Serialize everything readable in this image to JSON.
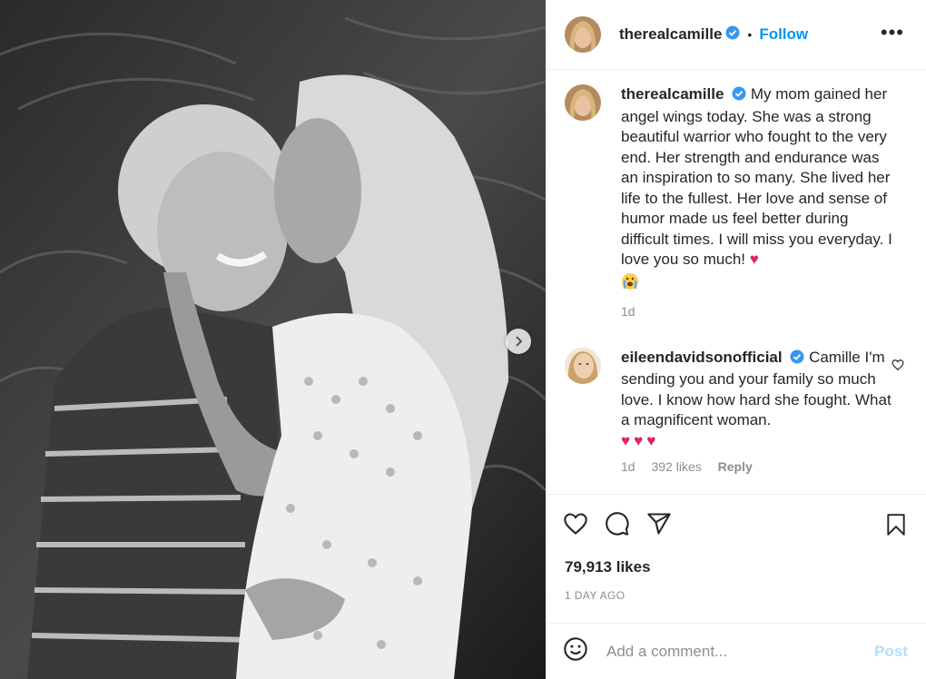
{
  "post": {
    "author": "therealcamille",
    "follow_label": "Follow",
    "dot": "•",
    "more": "•••"
  },
  "caption": {
    "username": "therealcamille",
    "text": "My mom gained her angel wings today. She was a strong beautiful warrior who fought to the very end. Her strength and endurance was an inspiration to so many. She lived her life to the fullest. Her love and sense of humor made us feel better during difficult times. I will miss you everyday. I love you so much!",
    "heart": "♥",
    "time": "1d"
  },
  "comment": {
    "username": "eileendavidsonofficial",
    "text": "Camille I'm sending you and your family so much love. I know how hard she fought. What a magnificent woman.",
    "hearts": "♥♥♥",
    "time": "1d",
    "likes": "392 likes",
    "reply": "Reply"
  },
  "stats": {
    "likes": "79,913 likes",
    "posted": "1 DAY AGO"
  },
  "composer": {
    "placeholder": "Add a comment...",
    "post_label": "Post"
  },
  "icons": {
    "like": "heart-icon",
    "comment": "comment-icon",
    "share": "share-icon",
    "save": "bookmark-icon",
    "emoji": "emoji-icon",
    "next": "chevron-right-icon",
    "verified": "verified-badge-icon"
  },
  "colors": {
    "accent": "#0095f6",
    "heart": "#e0245e",
    "muted": "#8e8e8e",
    "post_disabled": "#b2dffc"
  }
}
